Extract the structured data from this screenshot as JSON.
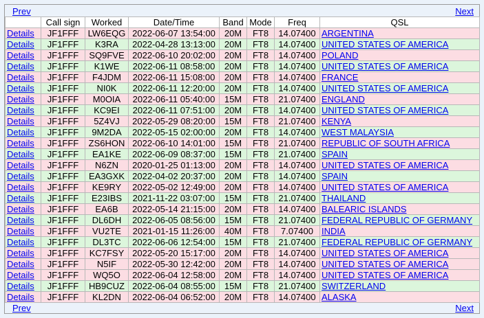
{
  "nav": {
    "prev_label": "Prev",
    "next_label": "Next"
  },
  "columns": [
    "",
    "Call sign",
    "Worked",
    "Date/Time",
    "Band",
    "Mode",
    "Freq",
    "QSL"
  ],
  "details_label": "Details",
  "rows": [
    {
      "shade": "pink",
      "call": "JF1FFF",
      "worked": "LW6EQG",
      "datetime": "2022-06-07 13:54:00",
      "band": "20M",
      "mode": "FT8",
      "freq": "14.07400",
      "qsl": "ARGENTINA"
    },
    {
      "shade": "green",
      "call": "JF1FFF",
      "worked": "K3RA",
      "datetime": "2022-04-28 13:13:00",
      "band": "20M",
      "mode": "FT8",
      "freq": "14.07400",
      "qsl": "UNITED STATES OF AMERICA"
    },
    {
      "shade": "pink",
      "call": "JF1FFF",
      "worked": "SQ9FVE",
      "datetime": "2022-06-10 20:02:00",
      "band": "20M",
      "mode": "FT8",
      "freq": "14.07400",
      "qsl": "POLAND"
    },
    {
      "shade": "green",
      "call": "JF1FFF",
      "worked": "K1WE",
      "datetime": "2022-06-11 08:58:00",
      "band": "20M",
      "mode": "FT8",
      "freq": "14.07400",
      "qsl": "UNITED STATES OF AMERICA"
    },
    {
      "shade": "pink",
      "call": "JF1FFF",
      "worked": "F4JDM",
      "datetime": "2022-06-11 15:08:00",
      "band": "20M",
      "mode": "FT8",
      "freq": "14.07400",
      "qsl": "FRANCE"
    },
    {
      "shade": "green",
      "call": "JF1FFF",
      "worked": "NI0K",
      "datetime": "2022-06-11 12:20:00",
      "band": "20M",
      "mode": "FT8",
      "freq": "14.07400",
      "qsl": "UNITED STATES OF AMERICA"
    },
    {
      "shade": "pink",
      "call": "JF1FFF",
      "worked": "M0OIA",
      "datetime": "2022-06-11 05:40:00",
      "band": "15M",
      "mode": "FT8",
      "freq": "21.07400",
      "qsl": "ENGLAND"
    },
    {
      "shade": "green",
      "call": "JF1FFF",
      "worked": "KC9EI",
      "datetime": "2022-06-11 07:51:00",
      "band": "20M",
      "mode": "FT8",
      "freq": "14.07400",
      "qsl": "UNITED STATES OF AMERICA"
    },
    {
      "shade": "pink",
      "call": "JF1FFF",
      "worked": "5Z4VJ",
      "datetime": "2022-05-29 08:20:00",
      "band": "15M",
      "mode": "FT8",
      "freq": "21.07400",
      "qsl": "KENYA"
    },
    {
      "shade": "green",
      "call": "JF1FFF",
      "worked": "9M2DA",
      "datetime": "2022-05-15 02:00:00",
      "band": "20M",
      "mode": "FT8",
      "freq": "14.07400",
      "qsl": "WEST MALAYSIA"
    },
    {
      "shade": "pink",
      "call": "JF1FFF",
      "worked": "ZS6HON",
      "datetime": "2022-06-10 14:01:00",
      "band": "15M",
      "mode": "FT8",
      "freq": "21.07400",
      "qsl": "REPUBLIC OF SOUTH AFRICA"
    },
    {
      "shade": "green",
      "call": "JF1FFF",
      "worked": "EA1KE",
      "datetime": "2022-06-09 08:37:00",
      "band": "15M",
      "mode": "FT8",
      "freq": "21.07400",
      "qsl": "SPAIN"
    },
    {
      "shade": "pink",
      "call": "JF1FFF",
      "worked": "N6ZN",
      "datetime": "2020-01-25 01:13:00",
      "band": "20M",
      "mode": "FT8",
      "freq": "14.07400",
      "qsl": "UNITED STATES OF AMERICA"
    },
    {
      "shade": "green",
      "call": "JF1FFF",
      "worked": "EA3GXK",
      "datetime": "2022-04-02 20:37:00",
      "band": "20M",
      "mode": "FT8",
      "freq": "14.07400",
      "qsl": "SPAIN"
    },
    {
      "shade": "pink",
      "call": "JF1FFF",
      "worked": "KE9RY",
      "datetime": "2022-05-02 12:49:00",
      "band": "20M",
      "mode": "FT8",
      "freq": "14.07400",
      "qsl": "UNITED STATES OF AMERICA"
    },
    {
      "shade": "green",
      "call": "JF1FFF",
      "worked": "E23IBS",
      "datetime": "2021-11-22 03:07:00",
      "band": "15M",
      "mode": "FT8",
      "freq": "21.07400",
      "qsl": "THAILAND"
    },
    {
      "shade": "pink",
      "call": "JF1FFF",
      "worked": "EA6B",
      "datetime": "2022-05-14 21:15:00",
      "band": "20M",
      "mode": "FT8",
      "freq": "14.07400",
      "qsl": "BALEARIC ISLANDS"
    },
    {
      "shade": "green",
      "call": "JF1FFF",
      "worked": "DL6DH",
      "datetime": "2022-06-05 08:56:00",
      "band": "15M",
      "mode": "FT8",
      "freq": "21.07400",
      "qsl": "FEDERAL REPUBLIC OF GERMANY"
    },
    {
      "shade": "pink",
      "call": "JF1FFF",
      "worked": "VU2TE",
      "datetime": "2021-01-15 11:26:00",
      "band": "40M",
      "mode": "FT8",
      "freq": "7.07400",
      "qsl": "INDIA"
    },
    {
      "shade": "green",
      "call": "JF1FFF",
      "worked": "DL3TC",
      "datetime": "2022-06-06 12:54:00",
      "band": "15M",
      "mode": "FT8",
      "freq": "21.07400",
      "qsl": "FEDERAL REPUBLIC OF GERMANY"
    },
    {
      "shade": "pink",
      "call": "JF1FFF",
      "worked": "KC7FSY",
      "datetime": "2022-05-20 15:17:00",
      "band": "20M",
      "mode": "FT8",
      "freq": "14.07400",
      "qsl": "UNITED STATES OF AMERICA"
    },
    {
      "shade": "pink",
      "call": "JF1FFF",
      "worked": "N5IF",
      "datetime": "2022-05-30 12:42:00",
      "band": "20M",
      "mode": "FT8",
      "freq": "14.07400",
      "qsl": "UNITED STATES OF AMERICA"
    },
    {
      "shade": "pink",
      "call": "JF1FFF",
      "worked": "WQ5O",
      "datetime": "2022-06-04 12:58:00",
      "band": "20M",
      "mode": "FT8",
      "freq": "14.07400",
      "qsl": "UNITED STATES OF AMERICA"
    },
    {
      "shade": "green",
      "call": "JF1FFF",
      "worked": "HB9CUZ",
      "datetime": "2022-06-04 08:55:00",
      "band": "15M",
      "mode": "FT8",
      "freq": "21.07400",
      "qsl": "SWITZERLAND"
    },
    {
      "shade": "pink",
      "call": "JF1FFF",
      "worked": "KL2DN",
      "datetime": "2022-06-04 06:52:00",
      "band": "20M",
      "mode": "FT8",
      "freq": "14.07400",
      "qsl": "ALASKA"
    }
  ]
}
